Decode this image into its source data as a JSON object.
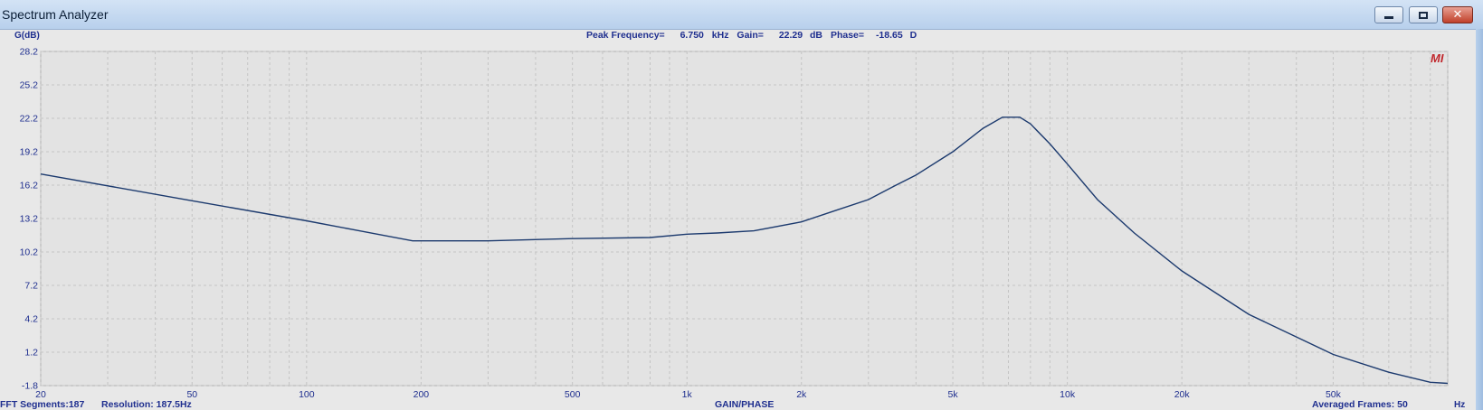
{
  "window": {
    "title": "Spectrum Analyzer",
    "controls": {
      "minimize": "minimize",
      "maximize": "maximize",
      "close": "✕"
    }
  },
  "header": {
    "peak_label": "Peak Frequency=",
    "peak_value": "6.750",
    "peak_unit": "kHz",
    "gain_label": "Gain=",
    "gain_value": "22.29",
    "gain_unit": "dB",
    "phase_label": "Phase=",
    "phase_value": "-18.65",
    "phase_unit": "D"
  },
  "logo": "MI",
  "footer": {
    "fft_segments": "FFT Segments:187",
    "resolution": "Resolution: 187.5Hz",
    "mode": "GAIN/PHASE",
    "averaged_frames": "Averaged Frames: 50"
  },
  "colors": {
    "plot_bg": "#e3e3e3",
    "grid": "#c4c4c4",
    "curve": "#1c3a6e",
    "label": "#1f2f8f",
    "logo": "#c0262b"
  },
  "chart_data": {
    "type": "line",
    "xscale": "log",
    "xlim": [
      20,
      100000
    ],
    "ylim": [
      -1.8,
      28.2
    ],
    "ylabel": "G(dB)",
    "xlabel": "Hz",
    "grid": true,
    "yticks": [
      28.2,
      25.2,
      22.2,
      19.2,
      16.2,
      13.2,
      10.2,
      7.2,
      4.2,
      1.2,
      -1.8
    ],
    "xticks": [
      {
        "value": 20,
        "label": "20"
      },
      {
        "value": 50,
        "label": "50"
      },
      {
        "value": 100,
        "label": "100"
      },
      {
        "value": 200,
        "label": "200"
      },
      {
        "value": 500,
        "label": "500"
      },
      {
        "value": 1000,
        "label": "1k"
      },
      {
        "value": 2000,
        "label": "2k"
      },
      {
        "value": 5000,
        "label": "5k"
      },
      {
        "value": 10000,
        "label": "10k"
      },
      {
        "value": 20000,
        "label": "20k"
      },
      {
        "value": 50000,
        "label": "50k"
      }
    ],
    "series": [
      {
        "x": [
          20,
          50,
          100,
          190,
          300,
          500,
          800,
          1000,
          1200,
          1500,
          2000,
          2500,
          3000,
          3500,
          4000,
          5000,
          6000,
          6750,
          7500,
          8000,
          9000,
          10000,
          12000,
          15000,
          20000,
          30000,
          50000,
          70000,
          90000,
          100000
        ],
        "y": [
          17.2,
          14.8,
          13.0,
          11.2,
          11.2,
          11.4,
          11.5,
          11.8,
          11.9,
          12.1,
          12.9,
          14.0,
          14.9,
          16.1,
          17.1,
          19.2,
          21.3,
          22.3,
          22.3,
          21.7,
          19.9,
          18.1,
          14.9,
          11.9,
          8.5,
          4.6,
          1.0,
          -0.6,
          -1.5,
          -1.6
        ]
      }
    ]
  }
}
